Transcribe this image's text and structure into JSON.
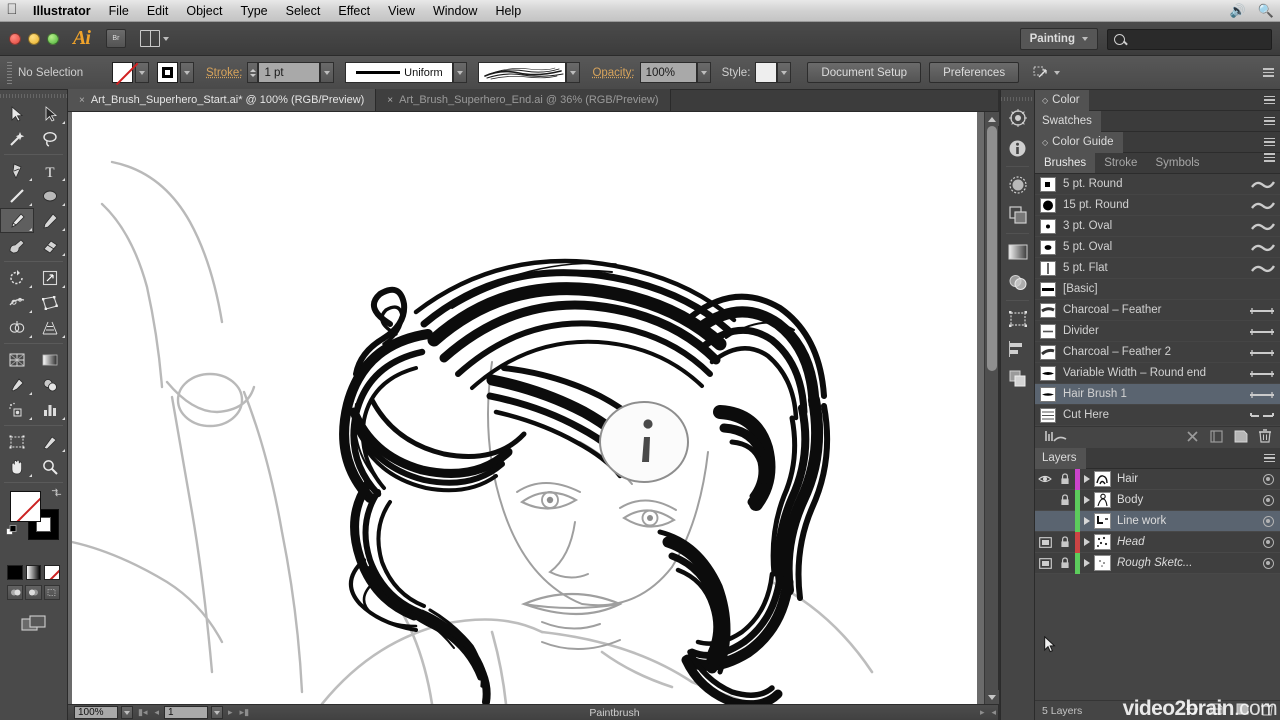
{
  "menubar": {
    "apple_icon": "apple-logo",
    "items": [
      "Illustrator",
      "File",
      "Edit",
      "Object",
      "Type",
      "Select",
      "Effect",
      "View",
      "Window",
      "Help"
    ],
    "right_icons": [
      "volume-icon",
      "spotlight-search-icon"
    ]
  },
  "appbar": {
    "app_logo": "Ai",
    "bridge_label": "Br",
    "arrange_icon": "arrange-documents-icon",
    "workspace": "Painting",
    "workspace_caret": "chevron-down-icon",
    "search_placeholder": "",
    "search_icon": "search-icon",
    "window_buttons": [
      "close-button",
      "minimize-button",
      "zoom-button"
    ]
  },
  "controlbar": {
    "selection_status": "No Selection",
    "fill_swatch": "none-fill-swatch",
    "stroke_swatch": "black-stroke-swatch",
    "stroke_label": "Stroke:",
    "stroke_weight": "1 pt",
    "profile_label": "Uniform",
    "brush_def_preview": "hair-brush-preview",
    "opacity_label": "Opacity:",
    "opacity_value": "100%",
    "style_label": "Style:",
    "document_setup": "Document Setup",
    "preferences": "Preferences",
    "transform_icon": "transform-icon",
    "panel_menu_icon": "panel-menu-icon"
  },
  "toolbar": {
    "selected_tool": "paintbrush-tool",
    "tools": [
      "selection-tool",
      "direct-selection-tool",
      "magic-wand-tool",
      "lasso-tool",
      "pen-tool",
      "type-tool",
      "line-segment-tool",
      "ellipse-tool",
      "paintbrush-tool",
      "pencil-tool",
      "blob-brush-tool",
      "eraser-tool",
      "rotate-tool",
      "scale-tool",
      "width-tool",
      "free-transform-tool",
      "shape-builder-tool",
      "perspective-grid-tool",
      "mesh-tool",
      "gradient-tool",
      "eyedropper-tool",
      "blend-tool",
      "symbol-sprayer-tool",
      "column-graph-tool",
      "artboard-tool",
      "slice-tool",
      "hand-tool",
      "zoom-tool"
    ],
    "fill_color": "none",
    "stroke_color": "#000000",
    "mini_swatches": [
      "black-color-swatch",
      "gradient-swatch",
      "none-swatch"
    ],
    "view_modes": [
      "normal-screen-mode",
      "full-screen-menubar-mode",
      "full-screen-mode"
    ],
    "screen_mode_icon": "change-screen-mode-icon"
  },
  "document": {
    "tabs": [
      {
        "title": "Art_Brush_Superhero_Start.ai* @ 100% (RGB/Preview)",
        "active": true,
        "close": "×"
      },
      {
        "title": "Art_Brush_Superhero_End.ai @ 36% (RGB/Preview)",
        "active": false,
        "close": "×"
      }
    ],
    "artwork_description": "superhero-woman-hair-illustration"
  },
  "statusbar": {
    "zoom_level": "100%",
    "page_number": "1",
    "status_text": "Paintbrush",
    "first_page_icon": "first-page-icon",
    "prev_page_icon": "prev-page-icon",
    "next_page_icon": "next-page-icon",
    "last_page_icon": "last-page-icon"
  },
  "icondock": {
    "icons": [
      "brushes-stroke-icon",
      "info-icon",
      "appearance-icon",
      "transparency-icon",
      "gradient-icon",
      "transform-icon",
      "artboards-icon",
      "align-icon",
      "pathfinder-icon"
    ]
  },
  "panels": {
    "collapsed": [
      {
        "label": "Color",
        "diamond": "◇",
        "menu": "panel-menu-icon"
      },
      {
        "label": "Swatches",
        "diamond": "",
        "menu": "panel-menu-icon"
      },
      {
        "label": "Color Guide",
        "diamond": "◇",
        "menu": "panel-menu-icon"
      }
    ],
    "brushes": {
      "tabs": [
        {
          "label": "Brushes",
          "active": true
        },
        {
          "label": "Stroke",
          "active": false
        },
        {
          "label": "Symbols",
          "active": false
        }
      ],
      "items": [
        {
          "name": "5 pt. Round",
          "type": "calligraphic",
          "selected": false
        },
        {
          "name": "15 pt. Round",
          "type": "calligraphic",
          "selected": false
        },
        {
          "name": "3 pt. Oval",
          "type": "calligraphic",
          "selected": false
        },
        {
          "name": "5 pt. Oval",
          "type": "calligraphic",
          "selected": false
        },
        {
          "name": "5 pt. Flat",
          "type": "calligraphic",
          "selected": false
        },
        {
          "name": "[Basic]",
          "type": "basic",
          "selected": false
        },
        {
          "name": "Charcoal – Feather",
          "type": "art",
          "selected": false
        },
        {
          "name": "Divider",
          "type": "art",
          "selected": false
        },
        {
          "name": "Charcoal – Feather 2",
          "type": "art",
          "selected": false
        },
        {
          "name": "Variable Width – Round end",
          "type": "art",
          "selected": false
        },
        {
          "name": "Hair Brush 1",
          "type": "art",
          "selected": true
        },
        {
          "name": "Cut Here",
          "type": "pattern",
          "selected": false
        }
      ],
      "footer_icons": [
        "brush-libraries-menu-icon",
        "libraries-panel-icon",
        "remove-brush-stroke-icon",
        "options-of-selected-object-icon",
        "new-brush-icon",
        "delete-brush-icon"
      ]
    },
    "layers": {
      "title": "Layers",
      "menu": "panel-menu-icon",
      "rows": [
        {
          "name": "Hair",
          "visible": true,
          "locked": true,
          "color": "#cc44cc",
          "selected": false,
          "italic": false,
          "template": false
        },
        {
          "name": "Body",
          "visible": false,
          "locked": true,
          "color": "#5ccc5c",
          "selected": false,
          "italic": false,
          "template": false
        },
        {
          "name": "Line work",
          "visible": false,
          "locked": false,
          "color": "#5ccc5c",
          "selected": true,
          "italic": false,
          "template": false
        },
        {
          "name": "Head",
          "visible": true,
          "locked": true,
          "color": "#cc4444",
          "selected": false,
          "italic": true,
          "template": true
        },
        {
          "name": "Rough Sketc...",
          "visible": true,
          "locked": true,
          "color": "#5ccc5c",
          "selected": false,
          "italic": true,
          "template": true
        }
      ],
      "count_label": "5 Layers",
      "footer_icons": [
        "make-clipping-mask-icon",
        "create-new-sublayer-icon",
        "create-new-layer-icon",
        "delete-selection-icon"
      ]
    }
  },
  "watermark": {
    "brand": "video2brain",
    "suffix": ".com"
  },
  "colors": {
    "chrome_dark": "#454545",
    "panel_bg": "#3f3f3f",
    "selection_blue": "#5a6470",
    "accent_orange": "#d8a45c",
    "canvas_gray": "#6b6b6b"
  }
}
